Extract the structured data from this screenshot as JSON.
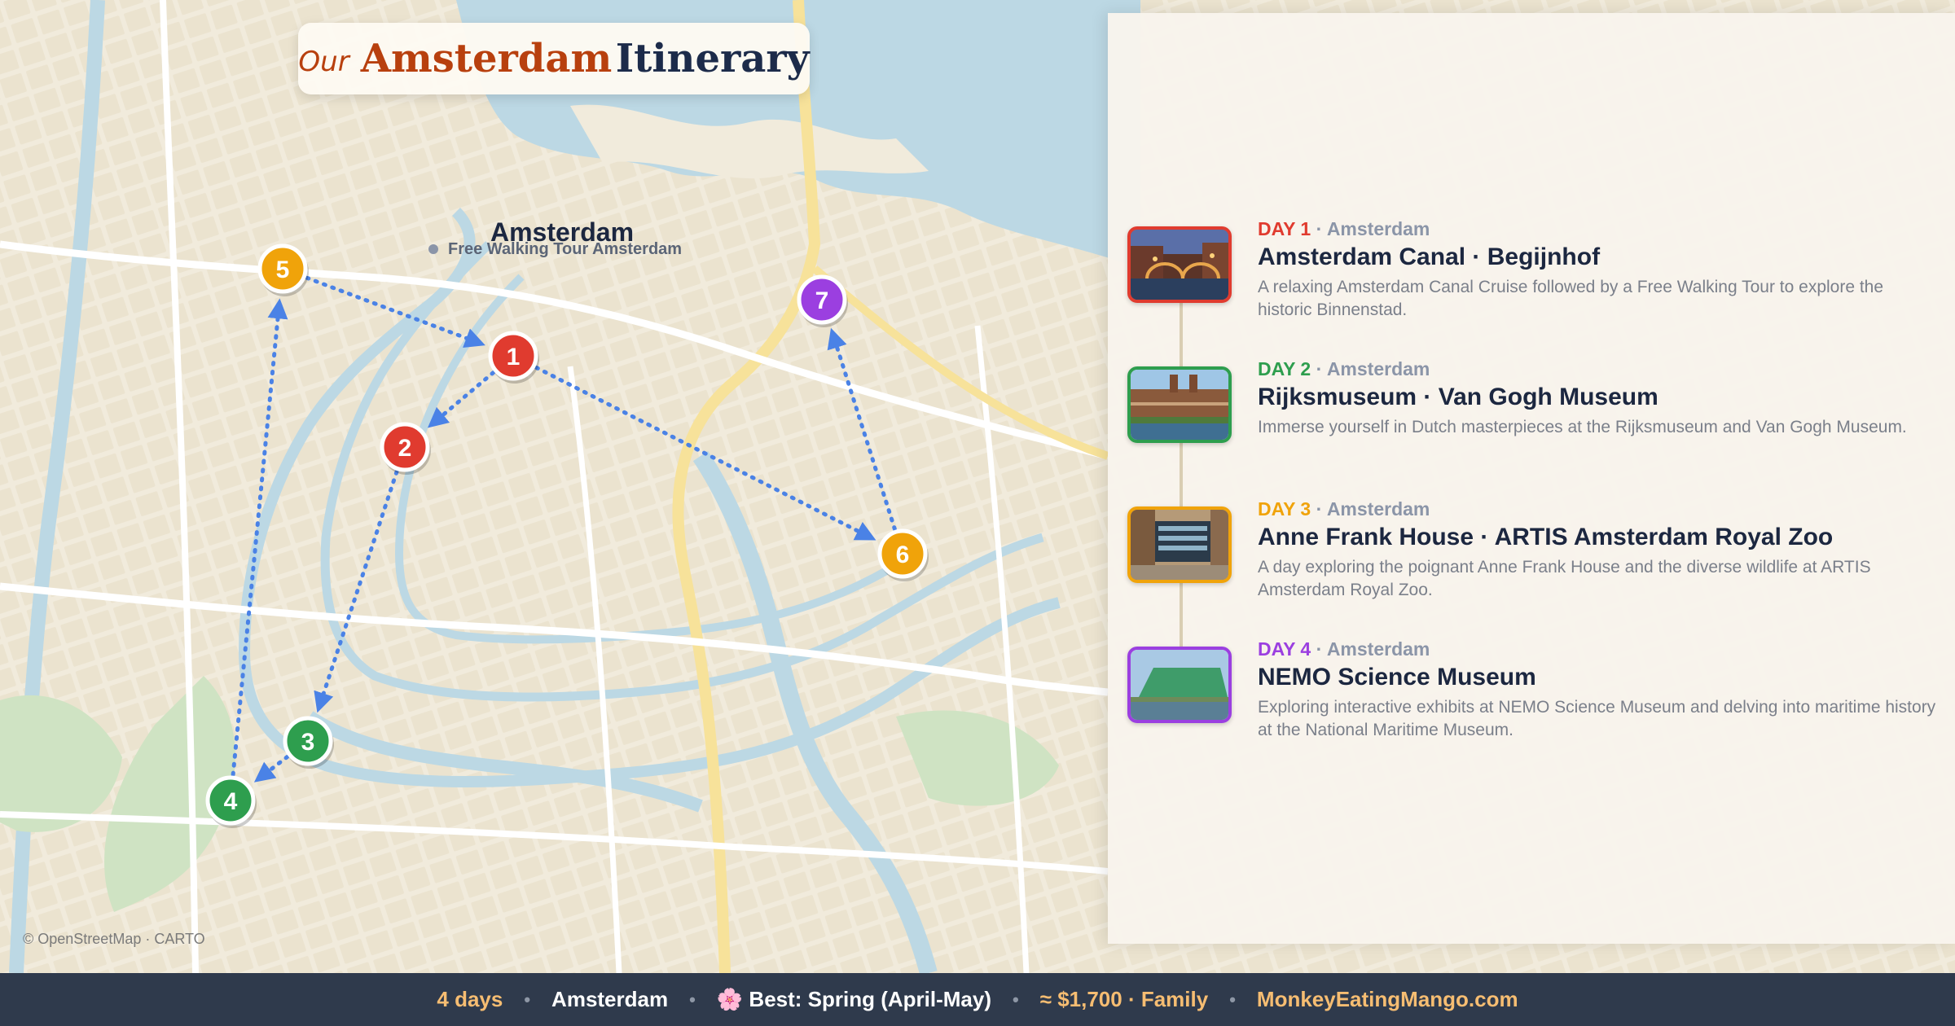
{
  "title": {
    "prefix": "Our",
    "city": "Amsterdam",
    "suffix": "Itinerary"
  },
  "map": {
    "city_label": "Amsterdam",
    "poi_label": "Free Walking Tour Amsterdam",
    "attribution": "© OpenStreetMap · CARTO",
    "markers": [
      {
        "label": "1",
        "color": "#e03b2f"
      },
      {
        "label": "2",
        "color": "#e03b2f"
      },
      {
        "label": "3",
        "color": "#2e9e4e"
      },
      {
        "label": "4",
        "color": "#2e9e4e"
      },
      {
        "label": "5",
        "color": "#f0a30a"
      },
      {
        "label": "6",
        "color": "#f0a30a"
      },
      {
        "label": "7",
        "color": "#9b3fe0"
      }
    ],
    "route_color": "#4a82e6"
  },
  "days": [
    {
      "day_label": "DAY 1",
      "city": "Amsterdam",
      "color": "#e03b2f",
      "title": "Amsterdam Canal · Begijnhof",
      "desc": "A relaxing Amsterdam Canal Cruise followed by a Free Walking Tour to explore the historic Binnenstad."
    },
    {
      "day_label": "DAY 2",
      "city": "Amsterdam",
      "color": "#2e9e4e",
      "title": "Rijksmuseum · Van Gogh Museum",
      "desc": "Immerse yourself in Dutch masterpieces at the Rijksmuseum and Van Gogh Museum."
    },
    {
      "day_label": "DAY 3",
      "city": "Amsterdam",
      "color": "#f0a30a",
      "title": "Anne Frank House · ARTIS Amsterdam Royal Zoo",
      "desc": "A day exploring the poignant Anne Frank House and the diverse wildlife at ARTIS Amsterdam Royal Zoo."
    },
    {
      "day_label": "DAY 4",
      "city": "Amsterdam",
      "color": "#9b3fe0",
      "title": "NEMO Science Museum",
      "desc": "Exploring interactive exhibits at NEMO Science Museum and delving into maritime history at the National Maritime Museum."
    }
  ],
  "footer": {
    "duration": "4 days",
    "city": "Amsterdam",
    "season_icon": "🌸",
    "season": "Best: Spring (April-May)",
    "budget": "≈ $1,700 · Family",
    "site": "MonkeyEatingMango.com"
  }
}
